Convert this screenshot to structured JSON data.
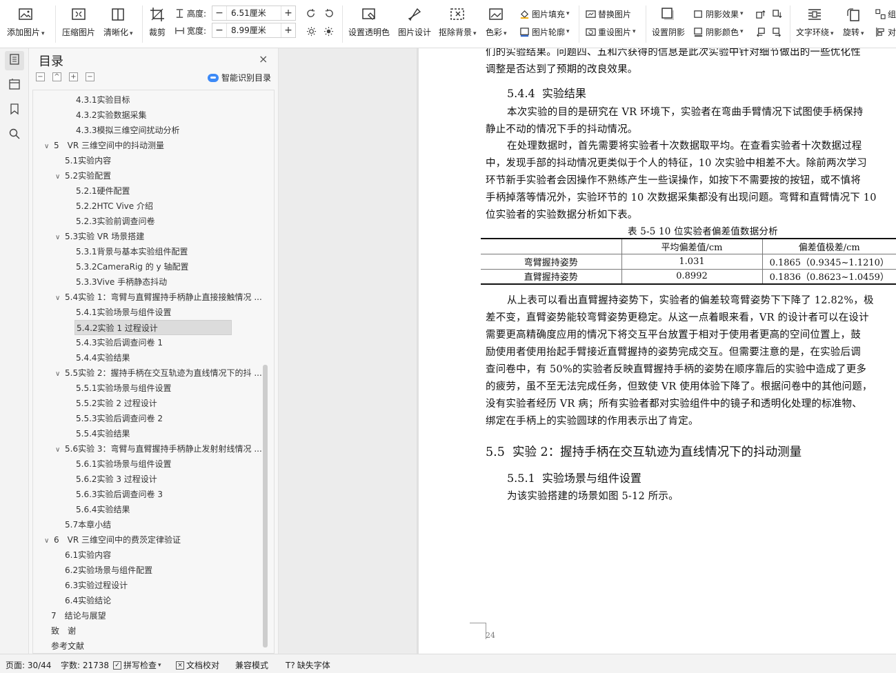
{
  "ribbon": {
    "add_image": "添加图片",
    "compress_image": "压缩图片",
    "sharpen": "清晰化",
    "crop": "裁剪",
    "height_label": "高度:",
    "height_value": "6.51厘米",
    "width_label": "宽度:",
    "width_value": "8.99厘米",
    "set_transparent": "设置透明色",
    "image_design": "图片设计",
    "remove_background": "抠除背景",
    "color": "色彩",
    "image_fill": "图片填充",
    "image_outline": "图片轮廓",
    "replace_image": "替换图片",
    "reset_image": "重设图片",
    "set_shadow": "设置阴影",
    "shadow_effect": "阴影效果",
    "shadow_color": "阴影颜色",
    "text_wrap": "文字环绕",
    "rotate": "旋转",
    "combine": "组",
    "align": "对"
  },
  "toc": {
    "title": "目录",
    "close": "×",
    "smart_label": "智能识别目录",
    "items": [
      {
        "label": "4.3.1实验目标",
        "level": 3
      },
      {
        "label": "4.3.2实验数据采集",
        "level": 3
      },
      {
        "label": "4.3.3模拟三维空间扰动分析",
        "level": 3
      },
      {
        "label": "5　VR 三维空间中的抖动测量",
        "level": 1,
        "arrow": "∨"
      },
      {
        "label": "5.1实验内容",
        "level": 2
      },
      {
        "label": "5.2实验配置",
        "level": 2,
        "arrow": "∨"
      },
      {
        "label": "5.2.1硬件配置",
        "level": 3
      },
      {
        "label": "5.2.2HTC Vive 介绍",
        "level": 3
      },
      {
        "label": "5.2.3实验前调查问卷",
        "level": 3
      },
      {
        "label": "5.3实验 VR 场景搭建",
        "level": 2,
        "arrow": "∨"
      },
      {
        "label": "5.3.1背景与基本实验组件配置",
        "level": 3
      },
      {
        "label": "5.3.2CameraRig 的 y 轴配置",
        "level": 3
      },
      {
        "label": "5.3.3Vive 手柄静态抖动",
        "level": 3
      },
      {
        "label": "5.4实验 1：弯臂与直臂握持手柄静止直接接触情况 ...",
        "level": 2,
        "arrow": "∨"
      },
      {
        "label": "5.4.1实验场景与组件设置",
        "level": 3
      },
      {
        "label": "5.4.2实验 1 过程设计",
        "level": 3,
        "selected": true
      },
      {
        "label": "5.4.3实验后调查问卷 1",
        "level": 3
      },
      {
        "label": "5.4.4实验结果",
        "level": 3
      },
      {
        "label": "5.5实验 2：握持手柄在交互轨迹为直线情况下的抖 ...",
        "level": 2,
        "arrow": "∨"
      },
      {
        "label": "5.5.1实验场景与组件设置",
        "level": 3
      },
      {
        "label": "5.5.2实验 2 过程设计",
        "level": 3
      },
      {
        "label": "5.5.3实验后调查问卷 2",
        "level": 3
      },
      {
        "label": "5.5.4实验结果",
        "level": 3
      },
      {
        "label": "5.6实验 3：弯臂与直臂握持手柄静止发射射线情况 ...",
        "level": 2,
        "arrow": "∨"
      },
      {
        "label": "5.6.1实验场景与组件设置",
        "level": 3
      },
      {
        "label": "5.6.2实验 3 过程设计",
        "level": 3
      },
      {
        "label": "5.6.3实验后调查问卷 3",
        "level": 3
      },
      {
        "label": "5.6.4实验结果",
        "level": 3
      },
      {
        "label": "5.7本章小结",
        "level": 2
      },
      {
        "label": "6　VR 三维空间中的费茨定律验证",
        "level": 1,
        "arrow": "∨"
      },
      {
        "label": "6.1实验内容",
        "level": 2
      },
      {
        "label": "6.2实验场景与组件配置",
        "level": 2
      },
      {
        "label": "6.3实验过程设计",
        "level": 2
      },
      {
        "label": "6.4实验结论",
        "level": 2
      },
      {
        "label": "7　结论与展望",
        "level": 1
      },
      {
        "label": "致　谢",
        "level": 1
      },
      {
        "label": "参考文献",
        "level": 1
      }
    ]
  },
  "document": {
    "top_line1": "们的实验结果。问题四、五和六获得的信息是此次实验中针对细节做出的一些优化性",
    "top_line2": "调整是否达到了预期的改良效果。",
    "h_544_num": "5.4.4",
    "h_544_text": "实验结果",
    "p1_line1": "本次实验的目的是研究在 VR 环境下，实验者在弯曲手臂情况下试图使手柄保持",
    "p1_line2": "静止不动的情况下手的抖动情况。",
    "p2_line1": "在处理数据时，首先需要将实验者十次数据取平均。在查看实验者十次数据过程",
    "p2_line2": "中，发现手部的抖动情况更类似于个人的特征，10 次实验中相差不大。除前两次学习",
    "p2_line3": "环节新手实验者会因操作不熟练产生一些误操作，如按下不需要按的按钮，或不慎将",
    "p2_line4": "手柄掉落等情况外，实验环节的 10 次数据采集都没有出现问题。弯臂和直臂情况下 10",
    "p2_line5": "位实验者的实验数据分析如下表。",
    "table_caption": "表 5-5 10 位实验者偏差值数据分析",
    "table_headers": [
      "",
      "平均偏差值/cm",
      "偏差值极差/cm"
    ],
    "table_rows": [
      [
        "弯臂握持姿势",
        "1.031",
        "0.1865（0.9345~1.1210）"
      ],
      [
        "直臂握持姿势",
        "0.8992",
        "0.1836（0.8623~1.0459）"
      ]
    ],
    "p3_line1": "从上表可以看出直臂握持姿势下，实验者的偏差较弯臂姿势下下降了 12.82%，极",
    "p3_line2": "差不变，直臂姿势能较弯臂姿势更稳定。从这一点着眼来看，VR 的设计者可以在设计",
    "p3_line3": "需要更高精确度应用的情况下将交互平台放置于相对于使用者更高的空间位置上，鼓",
    "p3_line4": "励使用者使用抬起手臂接近直臂握持的姿势完成交互。但需要注意的是，在实验后调",
    "p3_line5": "查问卷中，有 50%的实验者反映直臂握持手柄的姿势在顺序靠后的实验中造成了更多",
    "p3_line6": "的疲劳，虽不至无法完成任务，但致使 VR 使用体验下降了。根据问卷中的其他问题，",
    "p3_line7": "没有实验者经历 VR 病；所有实验者都对实验组件中的镜子和透明化处理的标准物、",
    "p3_line8": "绑定在手柄上的实验圆球的作用表示出了肯定。",
    "h_55_num": "5.5",
    "h_55_text": "实验 2：握持手柄在交互轨迹为直线情况下的抖动测量",
    "h_551_num": "5.5.1",
    "h_551_text": "实验场景与组件设置",
    "p4_line1": "为该实验搭建的场景如图 5-12 所示。",
    "page_number": "24"
  },
  "status": {
    "page": "页面: 30/44",
    "words": "字数: 21738",
    "spellcheck": "拼写检查",
    "proofread": "文档校对",
    "compat": "兼容模式",
    "missing_font": "缺失字体"
  }
}
